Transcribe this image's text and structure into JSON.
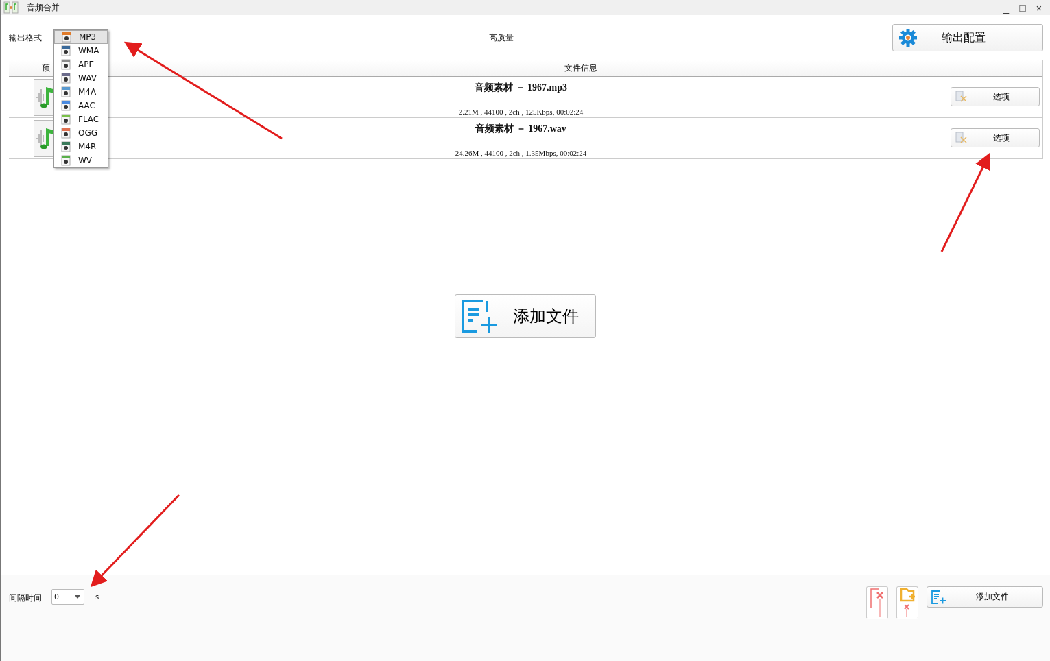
{
  "window": {
    "title": "音频合并",
    "controls": [
      "_",
      "□",
      "×"
    ]
  },
  "toolbar": {
    "format_label": "输出格式",
    "quality": "高质量",
    "config_button": "输出配置"
  },
  "format_menu": [
    {
      "label": "MP3",
      "selected": true,
      "color": "#e07b2a"
    },
    {
      "label": "WMA",
      "selected": false,
      "color": "#3a6a9a"
    },
    {
      "label": "APE",
      "selected": false,
      "color": "#8a8a8a"
    },
    {
      "label": "WAV",
      "selected": false,
      "color": "#6a6a8a"
    },
    {
      "label": "M4A",
      "selected": false,
      "color": "#5a9ad0"
    },
    {
      "label": "AAC",
      "selected": false,
      "color": "#4a8ae0"
    },
    {
      "label": "FLAC",
      "selected": false,
      "color": "#7ac04a"
    },
    {
      "label": "OGG",
      "selected": false,
      "color": "#e07050"
    },
    {
      "label": "M4R",
      "selected": false,
      "color": "#3a7a5a"
    },
    {
      "label": "WV",
      "selected": false,
      "color": "#5ab04a"
    }
  ],
  "table": {
    "columns": [
      "预",
      "文件信息"
    ],
    "rows": [
      {
        "name": "音频素材 － 1967.mp3",
        "info": "2.21M , 44100 , 2ch , 125Kbps, 00:02:24",
        "button": "选项"
      },
      {
        "name": "音频素材 － 1967.wav",
        "info": "24.26M , 44100 , 2ch , 1.35Mbps, 00:02:24",
        "button": "选项"
      }
    ]
  },
  "center_button": "添加文件",
  "bottom": {
    "interval_label": "间隔时间",
    "interval_value": "0",
    "unit": "s",
    "add_button": "添加文件"
  }
}
